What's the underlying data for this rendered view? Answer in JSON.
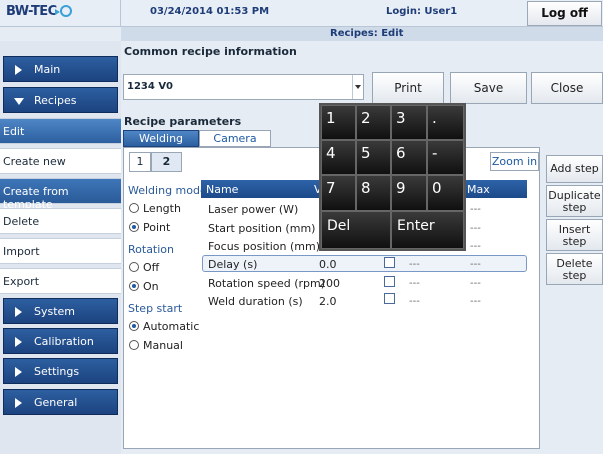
{
  "header": {
    "logo_text": "BW-TEC",
    "logo_tagline": "",
    "datetime": "03/24/2014 01:53 PM",
    "login": "Login: User1",
    "logoff_label": "Log off",
    "page_title": "Recipes: Edit"
  },
  "sidebar": {
    "main_label": "Main",
    "recipes_label": "Recipes",
    "items": [
      {
        "label": "Edit"
      },
      {
        "label": "Create new"
      },
      {
        "label": "Create from template"
      },
      {
        "label": "Delete"
      },
      {
        "label": "Import"
      },
      {
        "label": "Export"
      }
    ],
    "system_label": "System",
    "calibration_label": "Calibration",
    "settings_label": "Settings",
    "general_label": "General"
  },
  "common": {
    "title": "Common recipe information",
    "recipe_value": "1234 V0",
    "print_label": "Print",
    "save_label": "Save",
    "close_label": "Close"
  },
  "params": {
    "title": "Recipe parameters",
    "tab_welding": "Welding",
    "tab_camera": "Camera",
    "step1": "1",
    "step2": "2",
    "zoom_in": "Zoom in"
  },
  "options": {
    "welding_mode_label": "Welding mode",
    "length": "Length",
    "point": "Point",
    "rotation_label": "Rotation",
    "off": "Off",
    "on": "On",
    "step_start_label": "Step start",
    "automatic": "Automatic",
    "manual": "Manual"
  },
  "table": {
    "headers": {
      "name": "Name",
      "value": "V",
      "max": "Max"
    },
    "rows": [
      {
        "name": "Laser power (W)",
        "value": "",
        "min": "",
        "max": "---"
      },
      {
        "name": "Start position (mm)",
        "value": "",
        "min": "",
        "max": "---"
      },
      {
        "name": "Focus position (mm)",
        "value": "",
        "min": "",
        "max": "---"
      },
      {
        "name": "Delay (s)",
        "value": "0.0",
        "min": "---",
        "max": "---"
      },
      {
        "name": "Rotation speed (rpm)",
        "value": "200",
        "min": "---",
        "max": "---"
      },
      {
        "name": "Weld duration (s)",
        "value": "2.0",
        "min": "---",
        "max": "---"
      }
    ]
  },
  "steps": {
    "add": "Add step",
    "duplicate_1": "Duplicate",
    "duplicate_2": "step",
    "insert_1": "Insert",
    "insert_2": "step",
    "delete_1": "Delete",
    "delete_2": "step"
  },
  "keypad": {
    "k1": "1",
    "k2": "2",
    "k3": "3",
    "kdot": ".",
    "k4": "4",
    "k5": "5",
    "k6": "6",
    "kminus": "-",
    "k7": "7",
    "k8": "8",
    "k9": "9",
    "k0": "0",
    "del": "Del",
    "enter": "Enter"
  },
  "colors": {
    "accent": "#1c4380",
    "highlight": "#2c5fa0"
  }
}
